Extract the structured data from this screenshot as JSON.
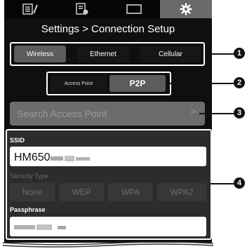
{
  "tabs": [
    {
      "icon": "list-edit-icon",
      "active": false
    },
    {
      "icon": "list-settings-icon",
      "active": false
    },
    {
      "icon": "display-icon",
      "active": false
    },
    {
      "icon": "gear-icon",
      "active": true
    }
  ],
  "header": {
    "title": "Settings > Connection Setup"
  },
  "connection": {
    "options": [
      "Wireless",
      "Ethernet",
      "Cellular"
    ],
    "selected": "Wireless"
  },
  "mode": {
    "options": [
      "Access Point",
      "P2P"
    ],
    "selected": "P2P"
  },
  "search": {
    "label": "Search Access Point",
    "chevron": ">"
  },
  "form": {
    "ssid_label": "SSID",
    "ssid_value": "HM650-",
    "security_label": "Security Type",
    "security_options": [
      "None",
      "WEP",
      "WPA",
      "WPA2"
    ],
    "passphrase_label": "Passphrase"
  },
  "callouts": [
    "1",
    "2",
    "3",
    "4"
  ],
  "colors": {
    "screen_bg": "#0f0f0f",
    "active_tab": "#6a6a6a",
    "highlight": "#5c5c5c",
    "outline": "#ffffff"
  }
}
